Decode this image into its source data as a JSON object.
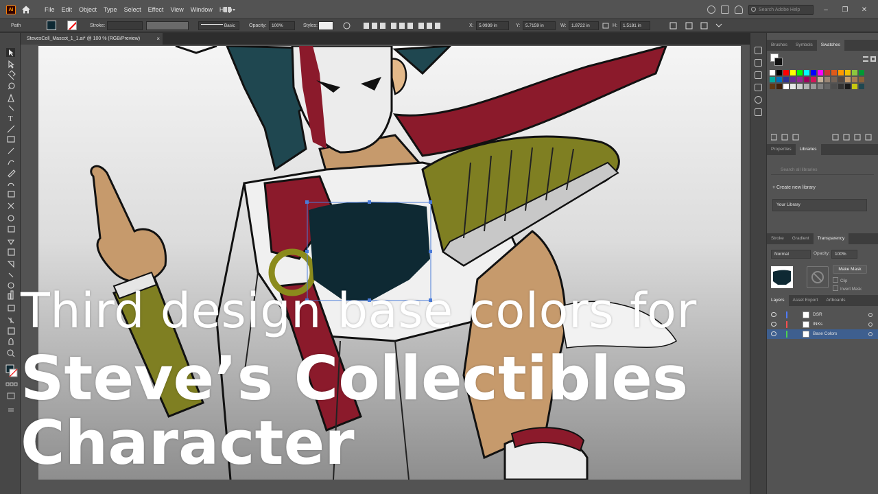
{
  "app": {
    "logo": "Ai"
  },
  "menu": [
    "File",
    "Edit",
    "Object",
    "Type",
    "Select",
    "Effect",
    "View",
    "Window",
    "Help"
  ],
  "search": {
    "placeholder": "Search Adobe Help"
  },
  "control": {
    "selection": "Path",
    "stroke_label": "Stroke:",
    "brush": "Basic",
    "opacity_label": "Opacity:",
    "opacity": "100%",
    "styles_label": "Styles:",
    "x_label": "X:",
    "x": "5.0939 in",
    "y_label": "Y:",
    "y": "5.7159 in",
    "w_label": "W:",
    "w": "1.8722 in",
    "h_label": "H:",
    "h": "1.5181 in"
  },
  "document": {
    "tab": "StevesColl_Mascot_1_1.ai* @ 100 % (RGB/Preview)",
    "close": "×"
  },
  "panels": {
    "swatches_tabs": [
      "Brushes",
      "Symbols",
      "Swatches"
    ],
    "props_tabs": [
      "Properties",
      "Libraries"
    ],
    "libraries": {
      "search_placeholder": "Search all libraries",
      "create": "+ Create new library",
      "selected": "Your Library"
    },
    "appearance_tabs": [
      "Stroke",
      "Gradient",
      "Transparency"
    ],
    "transparency": {
      "blend": "Normal",
      "opacity_label": "Opacity:",
      "opacity": "100%",
      "make_mask": "Make Mask",
      "clip": "Clip",
      "invert": "Invert Mask"
    },
    "layers_tabs": [
      "Layers",
      "Asset Export",
      "Artboards"
    ],
    "layers": [
      {
        "name": "DSR",
        "color": "#4f7bff"
      },
      {
        "name": "INKs",
        "color": "#ff4f4f"
      },
      {
        "name": "Base Colors",
        "color": "#4fd14f"
      }
    ]
  },
  "overlay": {
    "line1": "Third design base colors for",
    "line2": "Steve’s Collectibles",
    "line3": "Character"
  },
  "colors": {
    "hair": "#1f4750",
    "scarf": "#8b1a2b",
    "armor_green": "#7f7f22",
    "skin": "#c69a6c",
    "chest_fill": "#0e2933"
  },
  "swatch_colors": [
    "#ffffff",
    "#000000",
    "#ff0000",
    "#ffff00",
    "#00ff00",
    "#00ffff",
    "#0000ff",
    "#ff00ff",
    "#cc3333",
    "#e05a1a",
    "#ff9900",
    "#f2c200",
    "#8cc63f",
    "#009933",
    "#00a99d",
    "#0071bc",
    "#2e3192",
    "#662d91",
    "#93278f",
    "#9e005d",
    "#d4145a",
    "#c7b299",
    "#998675",
    "#736357",
    "#534741",
    "#c69c6d",
    "#a67c52",
    "#8c6239",
    "#603813",
    "#42210b",
    "#ffffff",
    "#e6e6e6",
    "#cccccc",
    "#b3b3b3",
    "#999999",
    "#808080",
    "#666666",
    "#4d4d4d",
    "#333333",
    "#1a1a1a",
    "#c8c810",
    "#1f4750"
  ]
}
